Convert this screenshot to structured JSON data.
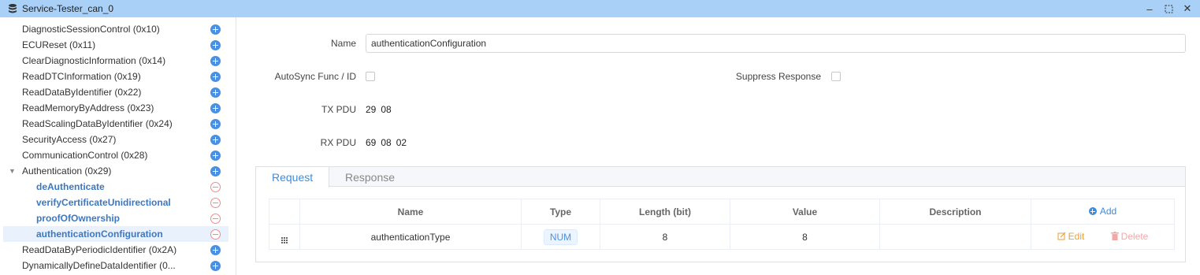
{
  "window": {
    "title": "Service-Tester_can_0"
  },
  "sidebar": {
    "items": [
      {
        "label": "DiagnosticSessionControl (0x10)"
      },
      {
        "label": "ECUReset (0x11)"
      },
      {
        "label": "ClearDiagnosticInformation (0x14)"
      },
      {
        "label": "ReadDTCInformation (0x19)"
      },
      {
        "label": "ReadDataByIdentifier (0x22)"
      },
      {
        "label": "ReadMemoryByAddress (0x23)"
      },
      {
        "label": "ReadScalingDataByIdentifier (0x24)"
      },
      {
        "label": "SecurityAccess (0x27)"
      },
      {
        "label": "CommunicationControl (0x28)"
      },
      {
        "label": "Authentication (0x29)"
      },
      {
        "label": "deAuthenticate"
      },
      {
        "label": "verifyCertificateUnidirectional"
      },
      {
        "label": "proofOfOwnership"
      },
      {
        "label": "authenticationConfiguration"
      },
      {
        "label": "ReadDataByPeriodicIdentifier (0x2A)"
      },
      {
        "label": "DynamicallyDefineDataIdentifier (0..."
      }
    ]
  },
  "form": {
    "name_label": "Name",
    "name_value": "authenticationConfiguration",
    "autosync_label": "AutoSync Func / ID",
    "suppress_label": "Suppress Response",
    "tx_label": "TX PDU",
    "tx_bytes": [
      "29",
      "08"
    ],
    "rx_label": "RX PDU",
    "rx_bytes": [
      "69",
      "08",
      "02"
    ]
  },
  "tabs": [
    {
      "label": "Request"
    },
    {
      "label": "Response"
    }
  ],
  "table": {
    "headers": {
      "name": "Name",
      "type": "Type",
      "length": "Length (bit)",
      "value": "Value",
      "description": "Description",
      "add": "Add"
    },
    "rows": [
      {
        "name": "authenticationType",
        "type": "NUM",
        "length": "8",
        "value": "8",
        "description": "",
        "edit": "Edit",
        "delete": "Delete"
      }
    ]
  },
  "colors": {
    "titlebar": "#a9d1f7",
    "accent": "#3b8de0",
    "edit": "#e6a23c",
    "delete": "#f3a8a8"
  }
}
